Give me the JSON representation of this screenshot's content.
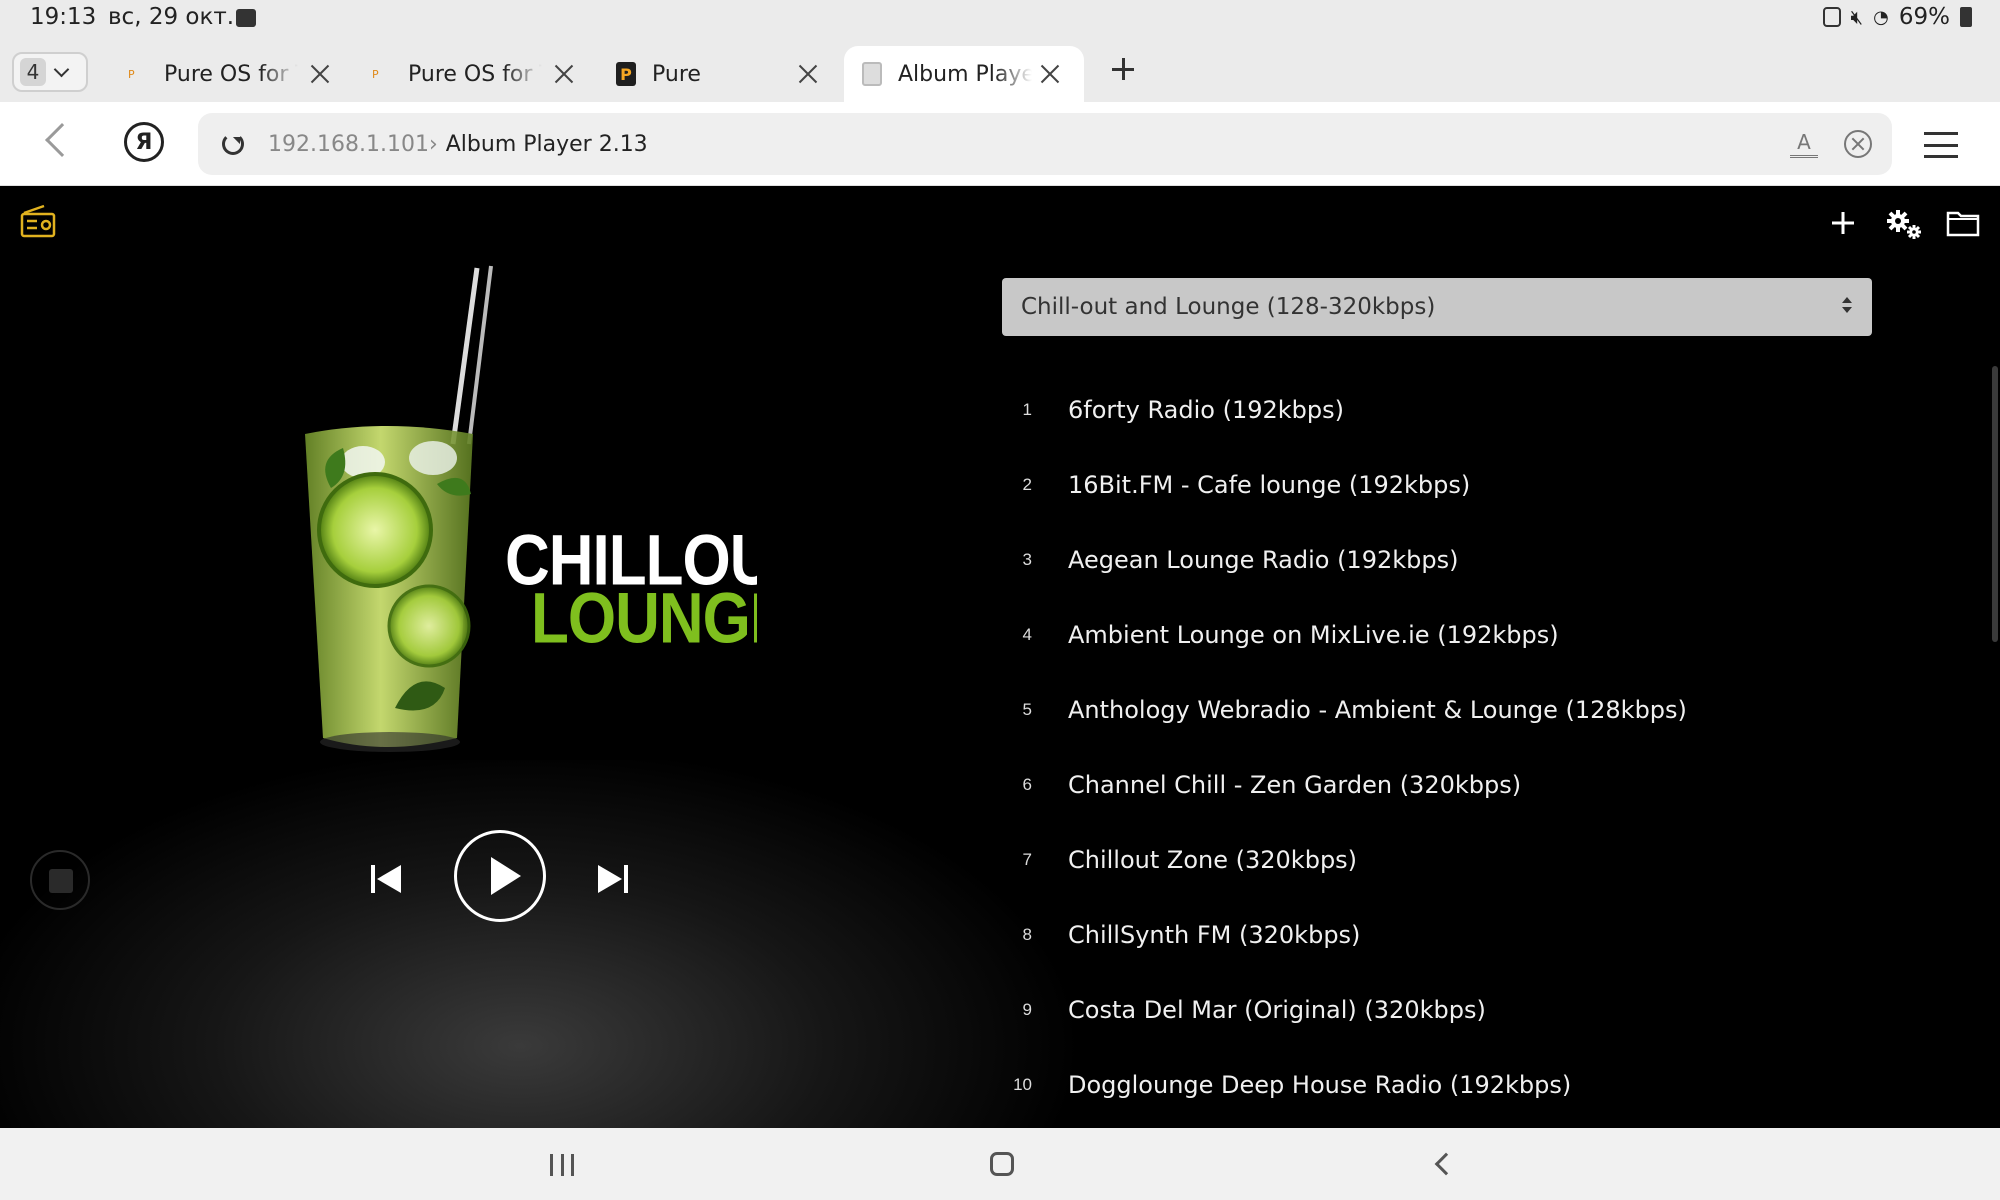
{
  "status_bar": {
    "time": "19:13",
    "date": "вс, 29 окт.",
    "battery": "69%"
  },
  "browser": {
    "tab_count": "4",
    "tabs": [
      {
        "label": "Pure OS for Ti",
        "icon": "pure-favicon",
        "active": false
      },
      {
        "label": "Pure OS for Ti",
        "icon": "pure-favicon",
        "active": false
      },
      {
        "label": "Pure",
        "icon": "pure-favicon-bold",
        "active": false
      },
      {
        "label": "Album Player",
        "icon": "album-player-favicon",
        "active": true
      }
    ],
    "address": {
      "host": "192.168.1.101›",
      "page_title": "Album Player 2.13"
    }
  },
  "player": {
    "cover": {
      "line1": "CHILLOUT",
      "line2": "LOUNGE",
      "accent_color": "#7fbf1e"
    },
    "controls": {
      "prev_icon": "skip-previous-icon",
      "play_icon": "play-icon",
      "next_icon": "skip-next-icon",
      "stop_icon": "stop-icon"
    },
    "top_icons": [
      "radio-icon",
      "add-icon",
      "settings-icon",
      "folder-icon"
    ],
    "genre_select": {
      "selected": "Chill-out and Lounge (128-320kbps)"
    },
    "stations": [
      {
        "num": "1",
        "title": "6forty Radio (192kbps)"
      },
      {
        "num": "2",
        "title": "16Bit.FM - Cafe lounge (192kbps)"
      },
      {
        "num": "3",
        "title": "Aegean Lounge Radio (192kbps)"
      },
      {
        "num": "4",
        "title": "Ambient Lounge on MixLive.ie (192kbps)"
      },
      {
        "num": "5",
        "title": "Anthology Webradio - Ambient & Lounge (128kbps)"
      },
      {
        "num": "6",
        "title": "Channel Chill - Zen Garden (320kbps)"
      },
      {
        "num": "7",
        "title": "Chillout Zone (320kbps)"
      },
      {
        "num": "8",
        "title": "ChillSynth FM (320kbps)"
      },
      {
        "num": "9",
        "title": "Costa Del Mar (Original) (320kbps)"
      },
      {
        "num": "10",
        "title": "Dogglounge Deep House Radio (192kbps)"
      }
    ]
  },
  "colors": {
    "radio_icon": "#e1b21f",
    "page_background": "#000000"
  }
}
